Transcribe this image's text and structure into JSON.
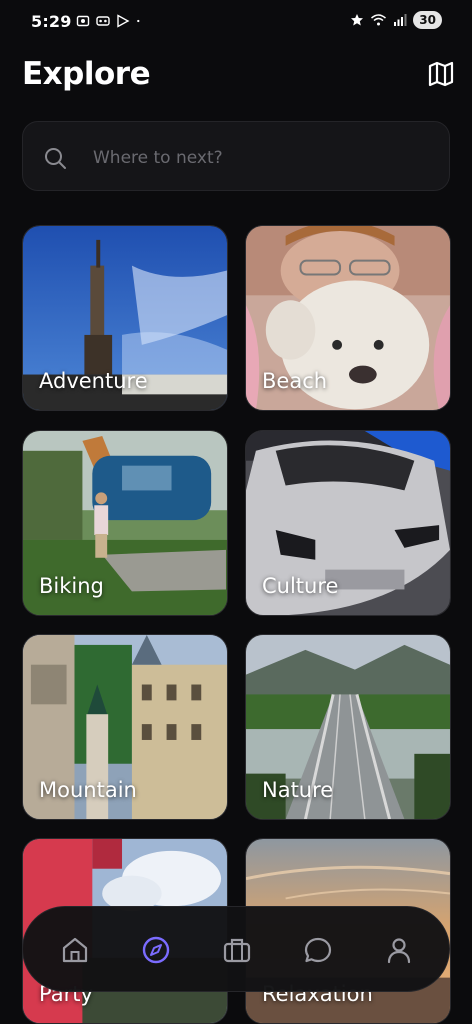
{
  "status_bar": {
    "time": "5:29",
    "battery": "30"
  },
  "header": {
    "title": "Explore",
    "map_icon": "map-icon"
  },
  "search": {
    "placeholder": "Where to next?",
    "value": "",
    "icon": "search-icon"
  },
  "categories": [
    {
      "label": "Adventure"
    },
    {
      "label": "Beach"
    },
    {
      "label": "Biking"
    },
    {
      "label": "Culture"
    },
    {
      "label": "Mountain"
    },
    {
      "label": "Nature"
    },
    {
      "label": "Party"
    },
    {
      "label": "Relaxation"
    }
  ],
  "bottom_nav": {
    "items": [
      {
        "name": "home",
        "icon": "home-icon",
        "active": false
      },
      {
        "name": "explore",
        "icon": "compass-icon",
        "active": true
      },
      {
        "name": "trips",
        "icon": "briefcase-icon",
        "active": false
      },
      {
        "name": "messages",
        "icon": "chat-icon",
        "active": false
      },
      {
        "name": "profile",
        "icon": "person-icon",
        "active": false
      }
    ]
  },
  "colors": {
    "background": "#0b0b0d",
    "accent": "#7b6cff",
    "surface": "#151518"
  }
}
